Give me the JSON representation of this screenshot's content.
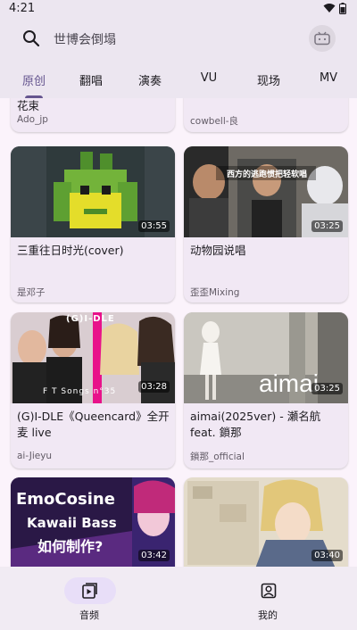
{
  "status": {
    "time": "4:21"
  },
  "search": {
    "placeholder": "世博会倒塌"
  },
  "tabs": [
    "原创",
    "翻唱",
    "演奏",
    "VU",
    "现场",
    "MV"
  ],
  "colors": {
    "accent": "#65558f",
    "header_bg": "#ece6f0",
    "card_bg": "#f1e8f4"
  },
  "cards": [
    {
      "title": "花束",
      "author": "Ado_jp",
      "duration": ""
    },
    {
      "title": "",
      "author": "cowbell-良",
      "duration": ""
    },
    {
      "title": "三重往日时光(cover)",
      "author": "是邓子",
      "duration": "03:55"
    },
    {
      "title": "动物园说唱",
      "author": "歪歪Mixing",
      "duration": "03:25",
      "thumb_caption": "西方的逃跑惯把轻软唱"
    },
    {
      "title": "(G)I-DLE《Queencard》全开麦 live",
      "author": "ai-Jieyu",
      "duration": "03:28",
      "thumb_caption": "(G)I-DLE",
      "thumb_subcaption": "F T Songs n°35"
    },
    {
      "title": "aimai(2025ver) - 瀬名航 feat. 鎖那",
      "author": "鎖那_official",
      "duration": "03:25",
      "thumb_caption": "aimai"
    },
    {
      "title": "",
      "author": "",
      "duration": "03:42",
      "thumb_caption": "EmoCosine",
      "thumb_subcaption": "Kawaii Bass",
      "thumb_caption3": "如何制作?"
    },
    {
      "title": "",
      "author": "",
      "duration": "03:40"
    }
  ],
  "nav": {
    "items": [
      {
        "label": "音频",
        "icon": "music-video-icon"
      },
      {
        "label": "我的",
        "icon": "profile-icon"
      }
    ]
  }
}
